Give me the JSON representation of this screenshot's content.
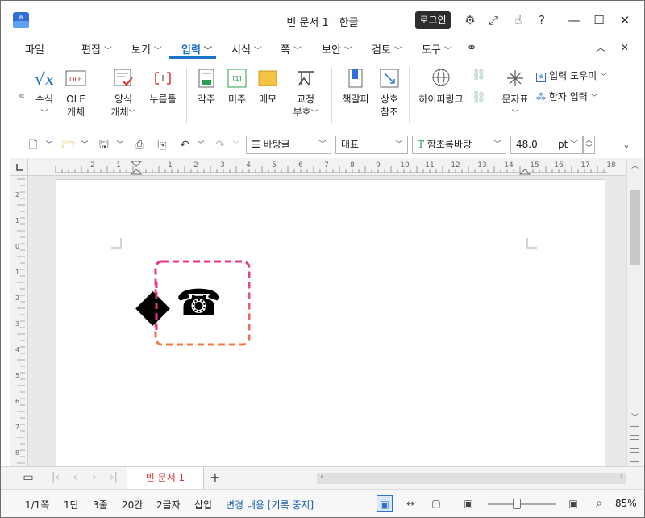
{
  "window": {
    "title": "빈 문서 1 - 한글",
    "login_label": "로그인"
  },
  "menu": {
    "file": "파일",
    "tabs": [
      "편집",
      "보기",
      "입력",
      "서식",
      "쪽",
      "보안",
      "검토",
      "도구"
    ],
    "active_tab": "입력"
  },
  "ribbon": {
    "equation": "수식",
    "ole": "OLE",
    "ole_line2": "개체",
    "ole_badge": "OLE",
    "form": "양식",
    "form_line2": "개체",
    "pushpin": "누름틀",
    "footnote": "각주",
    "endnote": "미주",
    "endnote_badge": "[1]",
    "memo": "메모",
    "proof": "교정",
    "proof_line2": "부호",
    "bookmark": "책갈피",
    "crossref": "상호",
    "crossref_line2": "참조",
    "hyperlink": "하이퍼링크",
    "charmap": "문자표",
    "input_helper": "입력 도우미",
    "hanja_input": "한자 입력"
  },
  "toolbar": {
    "style": "바탕글",
    "outline": "대표",
    "font": "함초롬바탕",
    "font_size": "48.0",
    "unit": "pt"
  },
  "ruler": {
    "h_ticks": [
      "2",
      "1",
      "1",
      "2",
      "3",
      "4",
      "5",
      "6",
      "7",
      "8",
      "9",
      "10",
      "11",
      "12",
      "13",
      "14",
      "15",
      "16",
      "17",
      "18"
    ],
    "v_ticks": [
      "2",
      "1",
      "0",
      "1",
      "2",
      "3",
      "4",
      "5",
      "6",
      "7",
      "8"
    ]
  },
  "document": {
    "symbols": [
      "◆",
      "☎"
    ],
    "selection_colors": {
      "top": "#e8338c",
      "bottom": "#f07a46"
    }
  },
  "tabs": {
    "doc_tab": "빈 문서 1",
    "add": "+"
  },
  "status": {
    "page": "1/1쪽",
    "section": "1단",
    "line": "3줄",
    "column": "20칸",
    "chars": "2글자",
    "mode": "삽입",
    "track": "변경 내용 [기록 중지]",
    "zoom": "85%"
  }
}
